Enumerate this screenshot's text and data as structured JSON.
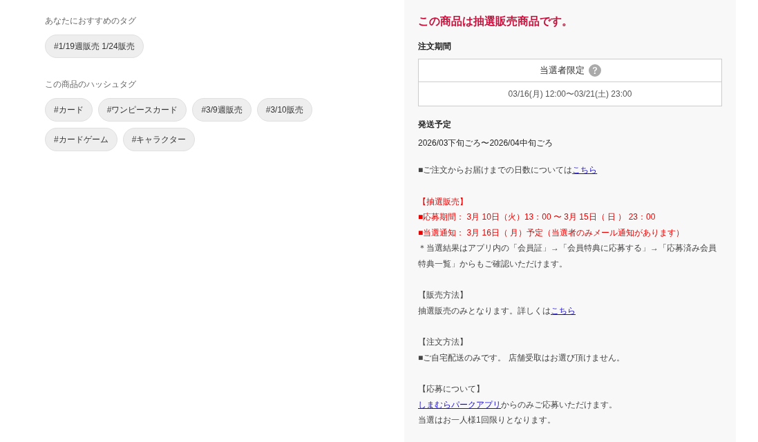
{
  "recommended_tags": {
    "heading": "あなたにおすすめのタグ",
    "tags": [
      "#1/19週販売 1/24販売"
    ]
  },
  "hashtags": {
    "heading": "この商品のハッシュタグ",
    "tags": [
      "#カード",
      "#ワンピースカード",
      "#3/9週販売",
      "#3/10販売",
      "#カードゲーム",
      "#キャラクター"
    ]
  },
  "lottery_panel": {
    "title": "この商品は抽選販売商品です。",
    "order_period": {
      "heading": "注文期間",
      "label": "当選者限定",
      "period": "03/16(月) 12:00〜03/21(土) 23:00"
    },
    "shipping": {
      "heading": "発送予定",
      "value": "2026/03下旬ごろ〜2026/04中旬ごろ"
    },
    "notes": [
      {
        "lines": [
          {
            "kind": "plain",
            "parts": [
              {
                "kind": "text",
                "text": "■ご注文からお届けまでの日数については"
              },
              {
                "kind": "link",
                "text": "こちら"
              }
            ]
          }
        ]
      },
      {
        "lines": [
          {
            "kind": "alert",
            "parts": [
              {
                "kind": "text",
                "text": "【抽選販売】"
              }
            ]
          },
          {
            "kind": "alert",
            "parts": [
              {
                "kind": "text",
                "text": "■応募期間： 3月 10日（火）13：00 〜 3月 15日（ 日 ） 23：00"
              }
            ]
          },
          {
            "kind": "alert",
            "parts": [
              {
                "kind": "text",
                "text": "■当選通知： 3月 16日（ 月）予定（当選者のみメール通知があります）"
              }
            ]
          },
          {
            "kind": "plain",
            "parts": [
              {
                "kind": "text",
                "text": "＊当選結果はアプリ内の「会員証」→「会員特典に応募する」→「応募済み会員特典一覧」からもご確認いただけます。"
              }
            ]
          }
        ]
      },
      {
        "lines": [
          {
            "kind": "plain",
            "parts": [
              {
                "kind": "text",
                "text": "【販売方法】"
              }
            ]
          },
          {
            "kind": "plain",
            "parts": [
              {
                "kind": "text",
                "text": "抽選販売のみとなります。詳しくは"
              },
              {
                "kind": "link",
                "text": "こちら"
              }
            ]
          }
        ]
      },
      {
        "lines": [
          {
            "kind": "plain",
            "parts": [
              {
                "kind": "text",
                "text": "【注文方法】"
              }
            ]
          },
          {
            "kind": "plain",
            "parts": [
              {
                "kind": "text",
                "text": "■ご自宅配送のみです。 店舗受取はお選び頂けません。"
              }
            ]
          }
        ]
      },
      {
        "lines": [
          {
            "kind": "plain",
            "parts": [
              {
                "kind": "text",
                "text": "【応募について】"
              }
            ]
          },
          {
            "kind": "plain",
            "parts": [
              {
                "kind": "link",
                "text": "しまむらパークアプリ"
              },
              {
                "kind": "text",
                "text": "からのみご応募いただけます。"
              }
            ]
          },
          {
            "kind": "plain",
            "parts": [
              {
                "kind": "text",
                "text": "当選はお一人様1回限りとなります。"
              }
            ]
          }
        ]
      }
    ]
  }
}
